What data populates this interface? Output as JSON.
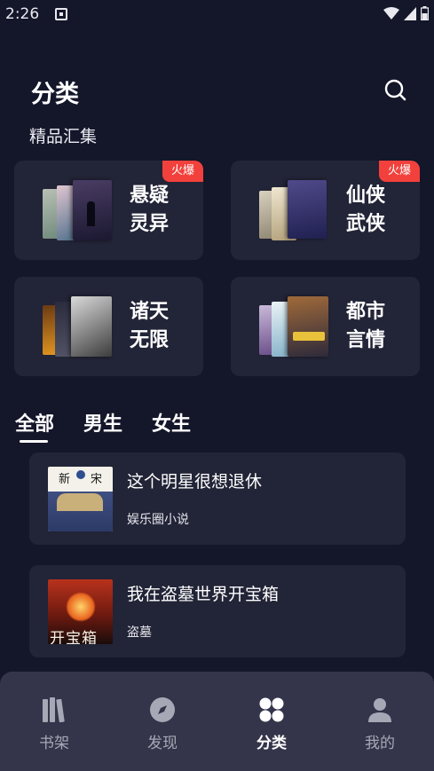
{
  "status_bar": {
    "time": "2:26"
  },
  "header": {
    "title": "分类"
  },
  "featured": {
    "section_title": "精品汇集",
    "categories": [
      {
        "name": "悬疑\n灵异",
        "badge": "火爆"
      },
      {
        "name": "仙侠\n武侠",
        "badge": "火爆"
      },
      {
        "name": "诸天\n无限",
        "badge": ""
      },
      {
        "name": "都市\n言情",
        "badge": ""
      }
    ]
  },
  "tabs": [
    {
      "label": "全部",
      "active": true
    },
    {
      "label": "男生",
      "active": false
    },
    {
      "label": "女生",
      "active": false
    }
  ],
  "books": [
    {
      "title": "这个明星很想退休",
      "tag": "娱乐圈小说",
      "cover_text_1": "新",
      "cover_text_2": "宋"
    },
    {
      "title": "我在盗墓世界开宝箱",
      "tag": "盗墓",
      "cover_text": "开宝箱"
    }
  ],
  "bottom_nav": [
    {
      "label": "书架",
      "icon": "bookshelf-icon",
      "active": false
    },
    {
      "label": "发现",
      "icon": "compass-icon",
      "active": false
    },
    {
      "label": "分类",
      "icon": "category-grid-icon",
      "active": true
    },
    {
      "label": "我的",
      "icon": "profile-icon",
      "active": false
    }
  ],
  "colors": {
    "background": "#14162a",
    "card": "#222437",
    "badge": "#f2413c",
    "nav_background": "#34354a"
  }
}
